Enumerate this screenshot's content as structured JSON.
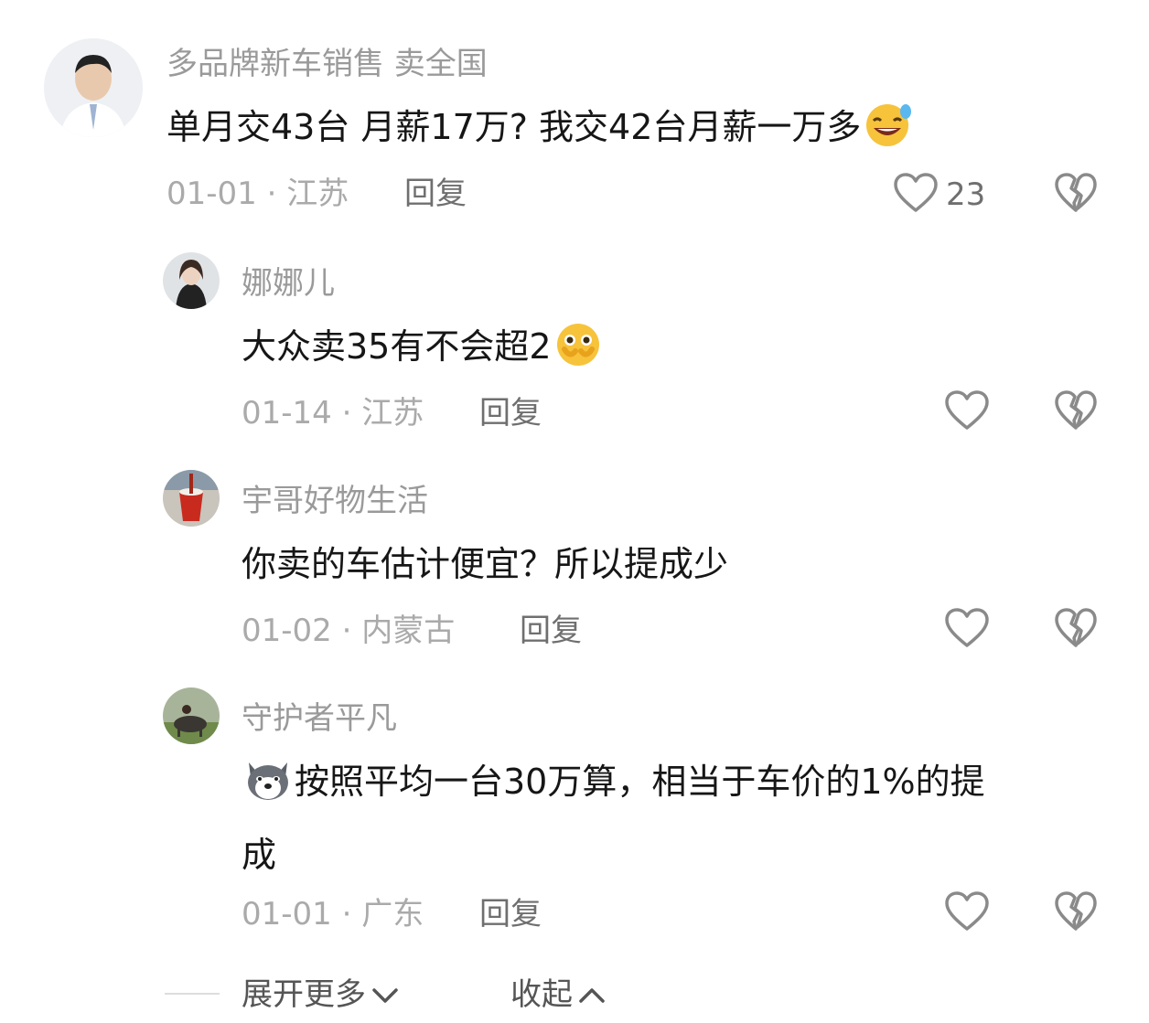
{
  "comments": [
    {
      "user": "多品牌新车销售 卖全国",
      "text": "单月交43台 月薪17万? 我交42台月薪一万多",
      "date_loc": "01-01 · 江苏",
      "reply": "回复",
      "likes": "23",
      "emoji": "grin-sweat-emoji"
    },
    {
      "user": "娜娜儿",
      "text": "大众卖35有不会超2",
      "date_loc": "01-14 · 江苏",
      "reply": "回复",
      "likes": "",
      "emoji": "teary-face-emoji"
    },
    {
      "user": "宇哥好物生活",
      "text": "你卖的车估计便宜？所以提成少",
      "date_loc": "01-02 · 内蒙古",
      "reply": "回复",
      "likes": ""
    },
    {
      "user": "守护者平凡",
      "text_line1": "按照平均一台30万算，相当于车价的1%的提",
      "text_line2": "成",
      "date_loc": "01-01 · 广东",
      "reply": "回复",
      "likes": "",
      "emoji": "husky-dog-emoji"
    }
  ],
  "footer": {
    "expand_label": "展开更多",
    "collapse_label": "收起"
  },
  "icons": {
    "like": "heart-outline-icon",
    "dislike": "broken-heart-icon",
    "expand": "chevron-down-icon",
    "collapse": "chevron-up-icon"
  },
  "colors": {
    "name": "#9a9a9a",
    "text": "#161616",
    "meta": "#aaaaaa",
    "action": "#6f6f6f"
  }
}
